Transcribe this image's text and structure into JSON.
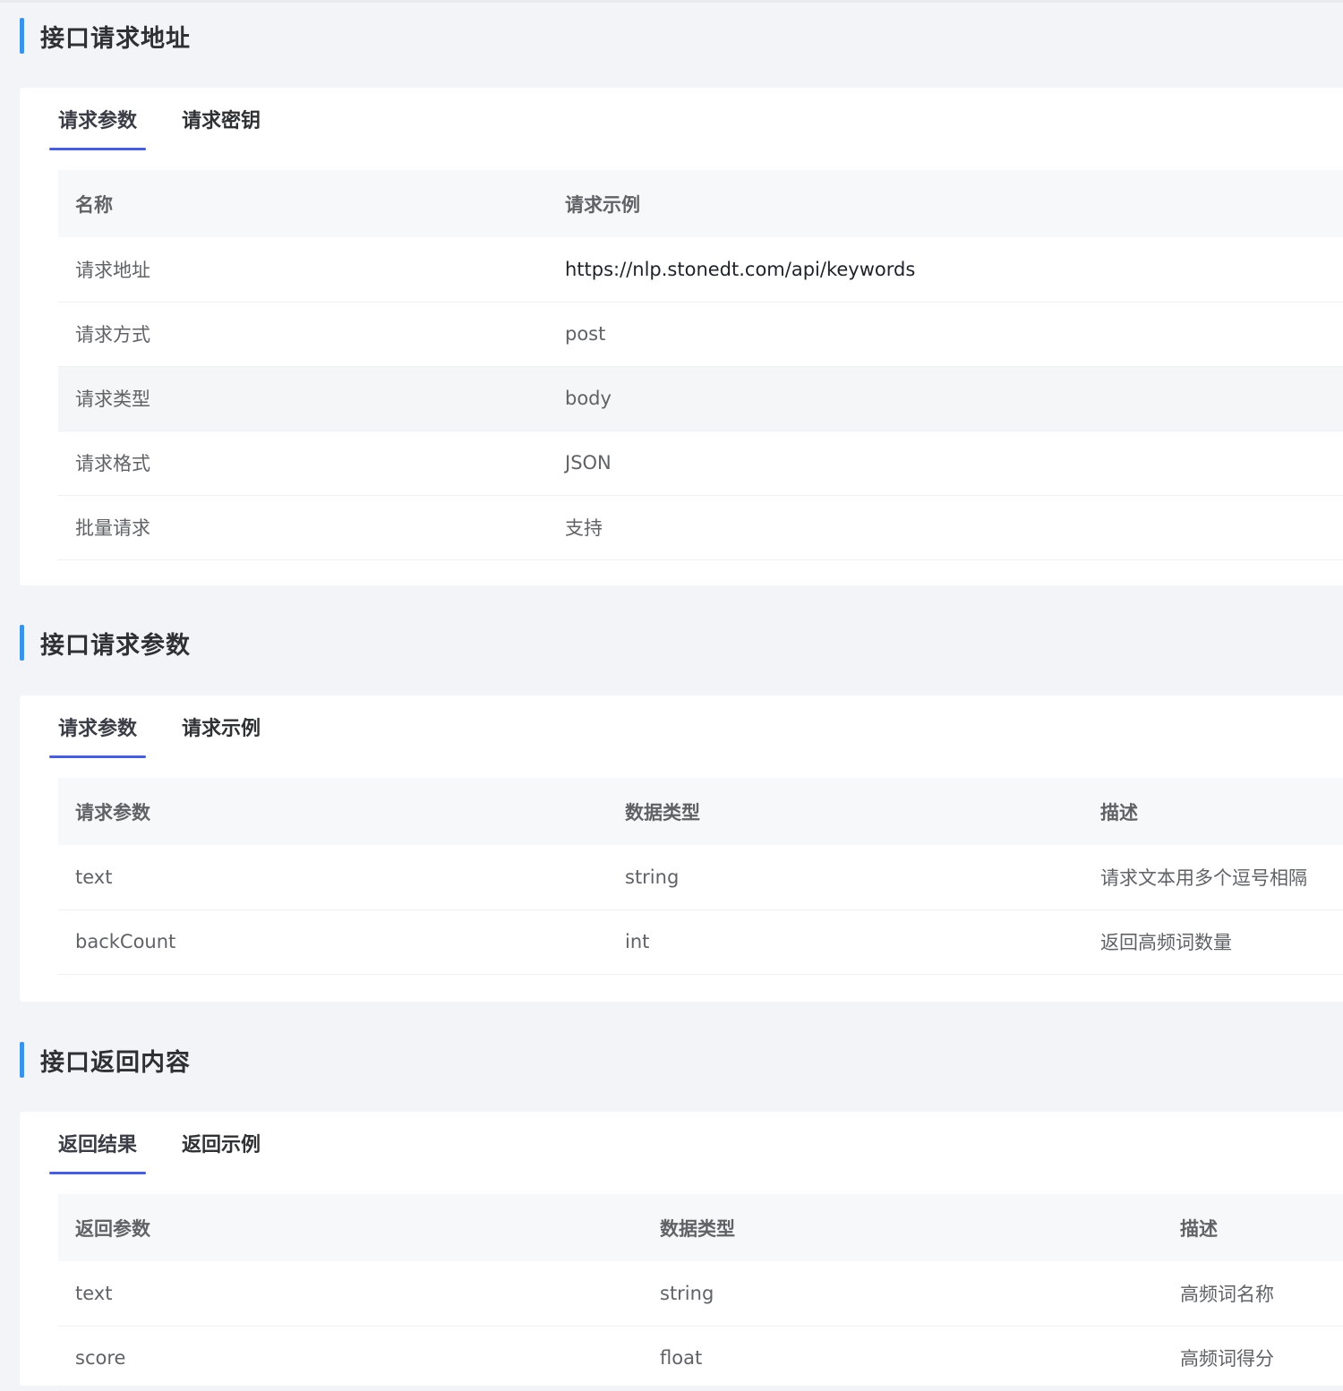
{
  "sections": [
    {
      "title": "接口请求地址",
      "tabs": [
        "请求参数",
        "请求密钥"
      ],
      "table": {
        "headers": [
          "名称",
          "请求示例"
        ],
        "rows": [
          [
            "请求地址",
            "https://nlp.stonedt.com/api/keywords"
          ],
          [
            "请求方式",
            "post"
          ],
          [
            "请求类型",
            "body"
          ],
          [
            "请求格式",
            "JSON"
          ],
          [
            "批量请求",
            "支持"
          ]
        ]
      }
    },
    {
      "title": "接口请求参数",
      "tabs": [
        "请求参数",
        "请求示例"
      ],
      "table": {
        "headers": [
          "请求参数",
          "数据类型",
          "描述"
        ],
        "rows": [
          [
            "text",
            "string",
            "请求文本用多个逗号相隔"
          ],
          [
            "backCount",
            "int",
            "返回高频词数量"
          ]
        ]
      }
    },
    {
      "title": "接口返回内容",
      "tabs": [
        "返回结果",
        "返回示例"
      ],
      "table": {
        "headers": [
          "返回参数",
          "数据类型",
          "描述"
        ],
        "rows": [
          [
            "text",
            "string",
            "高频词名称"
          ],
          [
            "score",
            "float",
            "高频词得分"
          ]
        ]
      }
    }
  ],
  "colors": {
    "accent_bar": "#3b93e8",
    "tab_underline": "#4b5fcf",
    "page_bg": "#f3f4f7"
  }
}
